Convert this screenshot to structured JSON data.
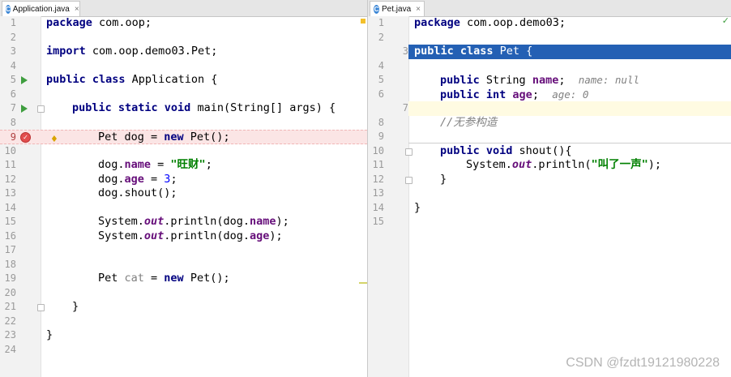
{
  "left_tab": {
    "icon": "C",
    "name": "Application.java",
    "close": "×"
  },
  "right_tab": {
    "icon": "C",
    "name": "Pet.java",
    "close": "×"
  },
  "left_lines": {
    "n1": "1",
    "n2": "2",
    "n3": "3",
    "n4": "4",
    "n5": "5",
    "n6": "6",
    "n7": "7",
    "n8": "8",
    "n9": "9",
    "n10": "10",
    "n11": "11",
    "n12": "12",
    "n13": "13",
    "n14": "14",
    "n15": "15",
    "n16": "16",
    "n17": "17",
    "n18": "18",
    "n19": "19",
    "n20": "20",
    "n21": "21",
    "n22": "22",
    "n23": "23",
    "n24": "24",
    "l1_kw": "package",
    "l1_rest": " com.oop;",
    "l3_kw": "import",
    "l3_rest": " com.oop.demo03.Pet;",
    "l5_kw": "public class",
    "l5_rest": " Application {",
    "l7_kw": "public static void",
    "l7_rest": " main(String[] args) {",
    "l9_a": "Pet dog = ",
    "l9_kw": "new",
    "l9_b": " Pet();",
    "l11_a": "dog.",
    "l11_f": "name",
    "l11_b": " = ",
    "l11_s": "\"旺财\"",
    "l11_c": ";",
    "l12_a": "dog.",
    "l12_f": "age",
    "l12_b": " = ",
    "l12_n": "3",
    "l12_c": ";",
    "l13_a": "dog.shout();",
    "l15_a": "System.",
    "l15_st": "out",
    "l15_b": ".println(dog.",
    "l15_f": "name",
    "l15_c": ");",
    "l16_a": "System.",
    "l16_st": "out",
    "l16_b": ".println(dog.",
    "l16_f": "age",
    "l16_c": ");",
    "l19_a": "Pet ",
    "l19_u": "cat",
    "l19_b": " = ",
    "l19_kw": "new",
    "l19_c": " Pet();",
    "l21": "}",
    "l23": "}"
  },
  "right_lines": {
    "n1": "1",
    "n2": "2",
    "n3": "3",
    "n4": "4",
    "n5": "5",
    "n6": "6",
    "n7": "7",
    "n8": "8",
    "n9": "9",
    "n10": "10",
    "n11": "11",
    "n12": "12",
    "n13": "13",
    "n14": "14",
    "n15": "15",
    "l1_kw": "package",
    "l1_rest": " com.oop.demo03;",
    "l3_kw": "public class",
    "l3_rest": " Pet {",
    "l5_kw": "public",
    "l5_a": " String ",
    "l5_f": "name",
    "l5_b": ";",
    "l5_hint": "name: null",
    "l6_kw": "public int",
    "l6_a": " ",
    "l6_f": "age",
    "l6_b": ";",
    "l6_hint": "age: 0",
    "l8_cm": "//无参构造",
    "l10_kw": "public void",
    "l10_a": " shout(){",
    "l11_a": "System.",
    "l11_st": "out",
    "l11_b": ".println(",
    "l11_s": "\"叫了一声\"",
    "l11_c": ");",
    "l12": "}",
    "l14": "}"
  },
  "watermark": "CSDN @fzdt19121980228",
  "colors": {
    "keyword": "#000080",
    "string": "#008000",
    "field": "#660e7a",
    "number": "#0000ff",
    "selection": "#2460b4",
    "error_row": "#fbe5e5"
  }
}
